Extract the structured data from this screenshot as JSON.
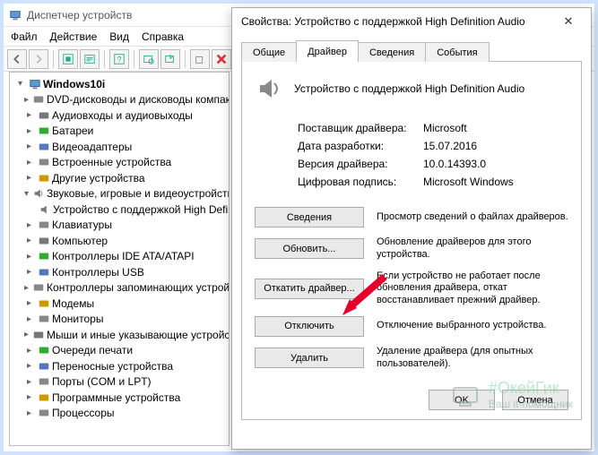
{
  "main": {
    "title": "Диспетчер устройств",
    "menu": {
      "file": "Файл",
      "action": "Действие",
      "view": "Вид",
      "help": "Справка"
    }
  },
  "tree": {
    "root": "Windows10i",
    "items": [
      "DVD-дисководы и дисководы компакт-дисков",
      "Аудиовходы и аудиовыходы",
      "Батареи",
      "Видеоадаптеры",
      "Встроенные устройства",
      "Другие устройства"
    ],
    "sound_cat": "Звуковые, игровые и видеоустройства",
    "sound_child": "Устройство с поддержкой High Definition Audio",
    "items2": [
      "Клавиатуры",
      "Компьютер",
      "Контроллеры IDE ATA/ATAPI",
      "Контроллеры USB",
      "Контроллеры запоминающих устройств",
      "Модемы",
      "Мониторы",
      "Мыши и иные указывающие устройства",
      "Очереди печати",
      "Переносные устройства",
      "Порты (COM и LPT)",
      "Программные устройства",
      "Процессоры"
    ]
  },
  "props": {
    "title": "Свойства: Устройство с поддержкой High Definition Audio",
    "tabs": {
      "general": "Общие",
      "driver": "Драйвер",
      "details": "Сведения",
      "events": "События"
    },
    "device_name": "Устройство с поддержкой High Definition Audio",
    "info": {
      "k1": "Поставщик драйвера:",
      "v1": "Microsoft",
      "k2": "Дата разработки:",
      "v2": "15.07.2016",
      "k3": "Версия драйвера:",
      "v3": "10.0.14393.0",
      "k4": "Цифровая подпись:",
      "v4": "Microsoft Windows"
    },
    "actions": {
      "details": {
        "btn": "Сведения",
        "desc": "Просмотр сведений о файлах драйверов."
      },
      "update": {
        "btn": "Обновить...",
        "desc": "Обновление драйверов для этого устройства."
      },
      "rollback": {
        "btn": "Откатить драйвер...",
        "desc": "Если устройство не работает после обновления драйвера, откат восстанавливает прежний драйвер."
      },
      "disable": {
        "btn": "Отключить",
        "desc": "Отключение выбранного устройства."
      },
      "uninstall": {
        "btn": "Удалить",
        "desc": "Удаление драйвера (для опытных пользователей)."
      }
    },
    "ok": "OK",
    "cancel": "Отмена"
  },
  "watermark": {
    "brand": "#ОкейГик",
    "tagline": "Ваш it-помощник"
  }
}
